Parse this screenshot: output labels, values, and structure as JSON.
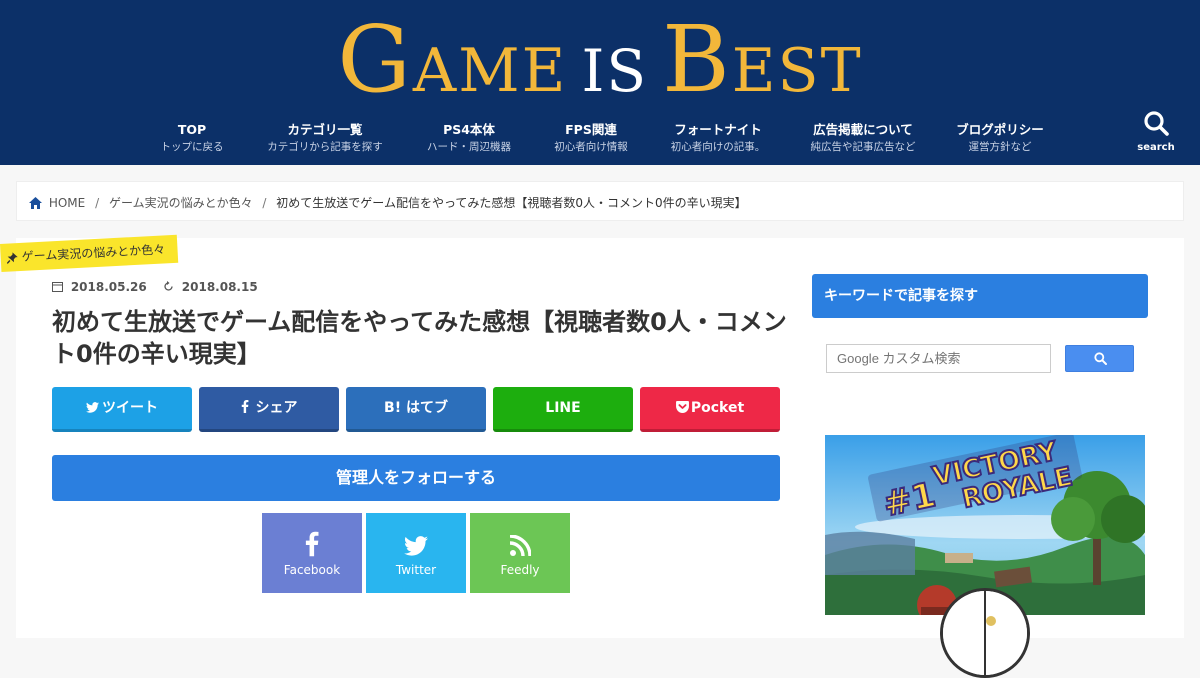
{
  "header": {
    "logo_game": "GAME",
    "logo_is": "IS",
    "logo_best": "BEST",
    "nav": [
      {
        "title": "TOP",
        "sub": "トップに戻る"
      },
      {
        "title": "カテゴリ一覧",
        "sub": "カテゴリから記事を探す"
      },
      {
        "title": "PS4本体",
        "sub": "ハード・周辺機器"
      },
      {
        "title": "FPS関連",
        "sub": "初心者向け情報"
      },
      {
        "title": "フォートナイト",
        "sub": "初心者向けの記事。"
      },
      {
        "title": "広告掲載について",
        "sub": "純広告や記事広告など"
      },
      {
        "title": "ブログポリシー",
        "sub": "運営方針など"
      }
    ],
    "search_label": "search",
    "bg_color": "#0c3068",
    "logo_color": "#f2b73a"
  },
  "breadcrumb": {
    "home": "HOME",
    "category": "ゲーム実況の悩みとか色々",
    "current": "初めて生放送でゲーム配信をやってみた感想【視聴者数0人・コメント0件の辛い現実】"
  },
  "article": {
    "category_tag": "ゲーム実況の悩みとか色々",
    "published": "2018.05.26",
    "updated": "2018.08.15",
    "title": "初めて生放送でゲーム配信をやってみた感想【視聴者数0人・コメント0件の辛い現実】",
    "share": [
      {
        "label": "ツイート",
        "icon": "twitter-icon",
        "color": "#1da1e6"
      },
      {
        "label": "シェア",
        "icon": "facebook-icon",
        "color": "#2f5ba3"
      },
      {
        "label": "B! はてブ",
        "icon": "hatena-icon",
        "color": "#2c6fbb"
      },
      {
        "label": "LINE",
        "icon": "line-icon",
        "color": "#1dae0e"
      },
      {
        "label": "Pocket",
        "icon": "pocket-icon",
        "color": "#ee2847"
      }
    ],
    "follow_label": "管理人をフォローする",
    "follow_boxes": [
      {
        "label": "Facebook",
        "icon": "facebook-icon",
        "color": "#6b7fd3"
      },
      {
        "label": "Twitter",
        "icon": "twitter-icon",
        "color": "#29b5ef"
      },
      {
        "label": "Feedly",
        "icon": "rss-icon",
        "color": "#6cc655"
      }
    ]
  },
  "sidebar": {
    "heading": "キーワードで記事を探す",
    "search_placeholder": "Google カスタム検索",
    "banner_text_1": "#1",
    "banner_text_2": "VICTORY",
    "banner_text_3": "ROYALE"
  }
}
